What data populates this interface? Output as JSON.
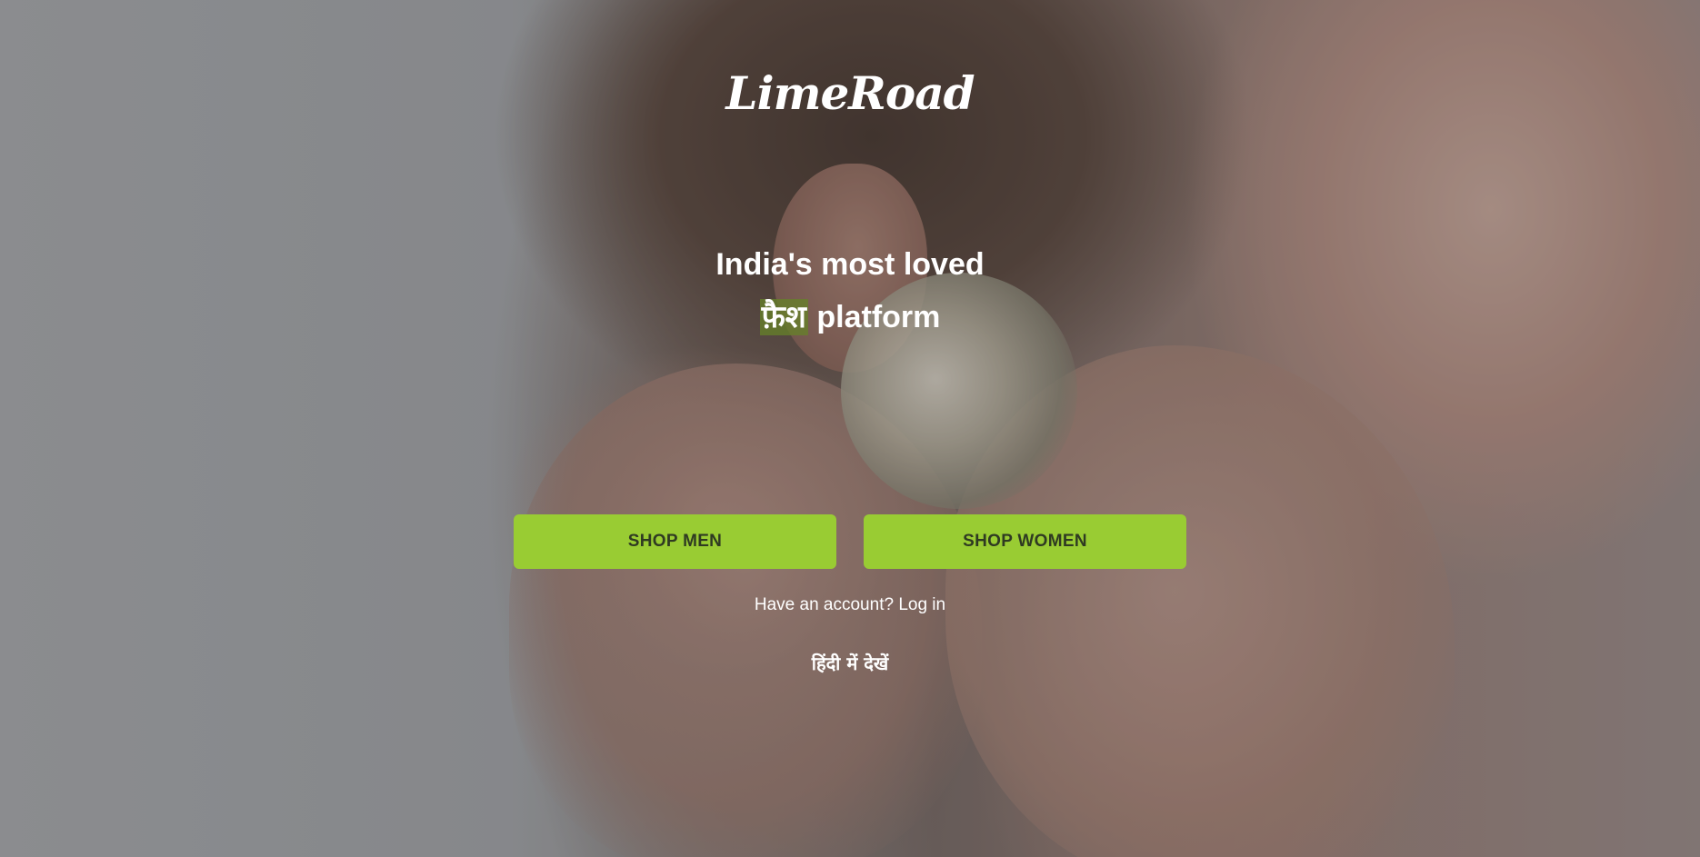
{
  "brand": {
    "logo_text": "LimeRoad"
  },
  "hero": {
    "line1": "India's most loved",
    "highlight_word": "फ़ैश",
    "line2_rest": "platform"
  },
  "actions": {
    "shop_men": "SHOP MEN",
    "shop_women": "SHOP WOMEN"
  },
  "account": {
    "prompt": "Have an account?",
    "login_link": "Log in"
  },
  "language": {
    "hindi_link": "हिंदी में देखें"
  },
  "colors": {
    "accent": "#99cc33",
    "button_text": "#2f3a22",
    "highlight_bg": "#658228",
    "text": "#ffffff"
  }
}
